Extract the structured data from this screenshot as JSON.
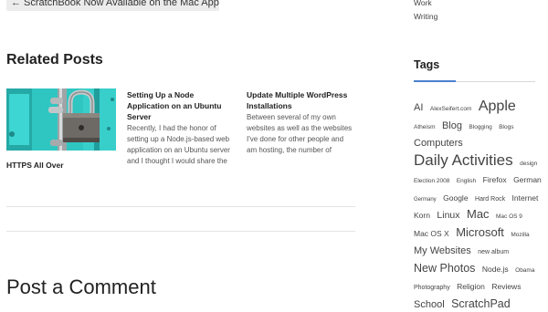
{
  "nav": {
    "previous_label": "← ScratchBook Now Available on the Mac App Store"
  },
  "categories": [
    "Work",
    "Writing"
  ],
  "related": {
    "heading": "Related Posts",
    "featured_title": "HTTPS All Over",
    "posts": [
      {
        "title": "Setting Up a Node Application on an Ubuntu Server",
        "excerpt": "Recently, I had the honor of setting up a Node.js-based web application on an Ubuntu server and I thought I would share the steps I took to get it up and"
      },
      {
        "title": "Update Multiple WordPress Installations",
        "excerpt": "Between several of my own websites as well as the websites I've done for other people and am hosting, the number of WordPress installations on my"
      }
    ]
  },
  "comment": {
    "heading": "Post a Comment"
  },
  "tags": {
    "heading": "Tags",
    "items": [
      {
        "label": "AI",
        "size": 11
      },
      {
        "label": "AlexSeifert.com",
        "size": 6.5
      },
      {
        "label": "Apple",
        "size": 16
      },
      {
        "label": "Atheism",
        "size": 6.5
      },
      {
        "label": "Blog",
        "size": 11
      },
      {
        "label": "Blogging",
        "size": 6.5
      },
      {
        "label": "Blogs",
        "size": 6.5
      },
      {
        "label": "Computers",
        "size": 11
      },
      {
        "label": "Daily Activities",
        "size": 17
      },
      {
        "label": "design",
        "size": 6.5
      },
      {
        "label": "Election 2008",
        "size": 6.5
      },
      {
        "label": "English",
        "size": 6.5
      },
      {
        "label": "Firefox",
        "size": 8.5
      },
      {
        "label": "German",
        "size": 8.5
      },
      {
        "label": "Germany",
        "size": 6
      },
      {
        "label": "Google",
        "size": 8.5
      },
      {
        "label": "Hard Rock",
        "size": 7
      },
      {
        "label": "Internet",
        "size": 8.5
      },
      {
        "label": "Korn",
        "size": 8.5
      },
      {
        "label": "Linux",
        "size": 10.5
      },
      {
        "label": "Mac",
        "size": 13
      },
      {
        "label": "Mac OS 9",
        "size": 6.5
      },
      {
        "label": "Mac OS X",
        "size": 8.5
      },
      {
        "label": "Microsoft",
        "size": 13
      },
      {
        "label": "Mozilla",
        "size": 6.5
      },
      {
        "label": "My Websites",
        "size": 11
      },
      {
        "label": "new album",
        "size": 7
      },
      {
        "label": "New Photos",
        "size": 12.5
      },
      {
        "label": "Node.js",
        "size": 8.5
      },
      {
        "label": "Obama",
        "size": 6.5
      },
      {
        "label": "Photography",
        "size": 7
      },
      {
        "label": "Religion",
        "size": 8.5
      },
      {
        "label": "Reviews",
        "size": 8.5
      },
      {
        "label": "School",
        "size": 11
      },
      {
        "label": "ScratchPad",
        "size": 12.5
      }
    ]
  },
  "colors": {
    "accent": "#4a7fcf",
    "text": "#333333",
    "rule": "#e4e4e4",
    "padlock_background": "#2fc6c2"
  }
}
